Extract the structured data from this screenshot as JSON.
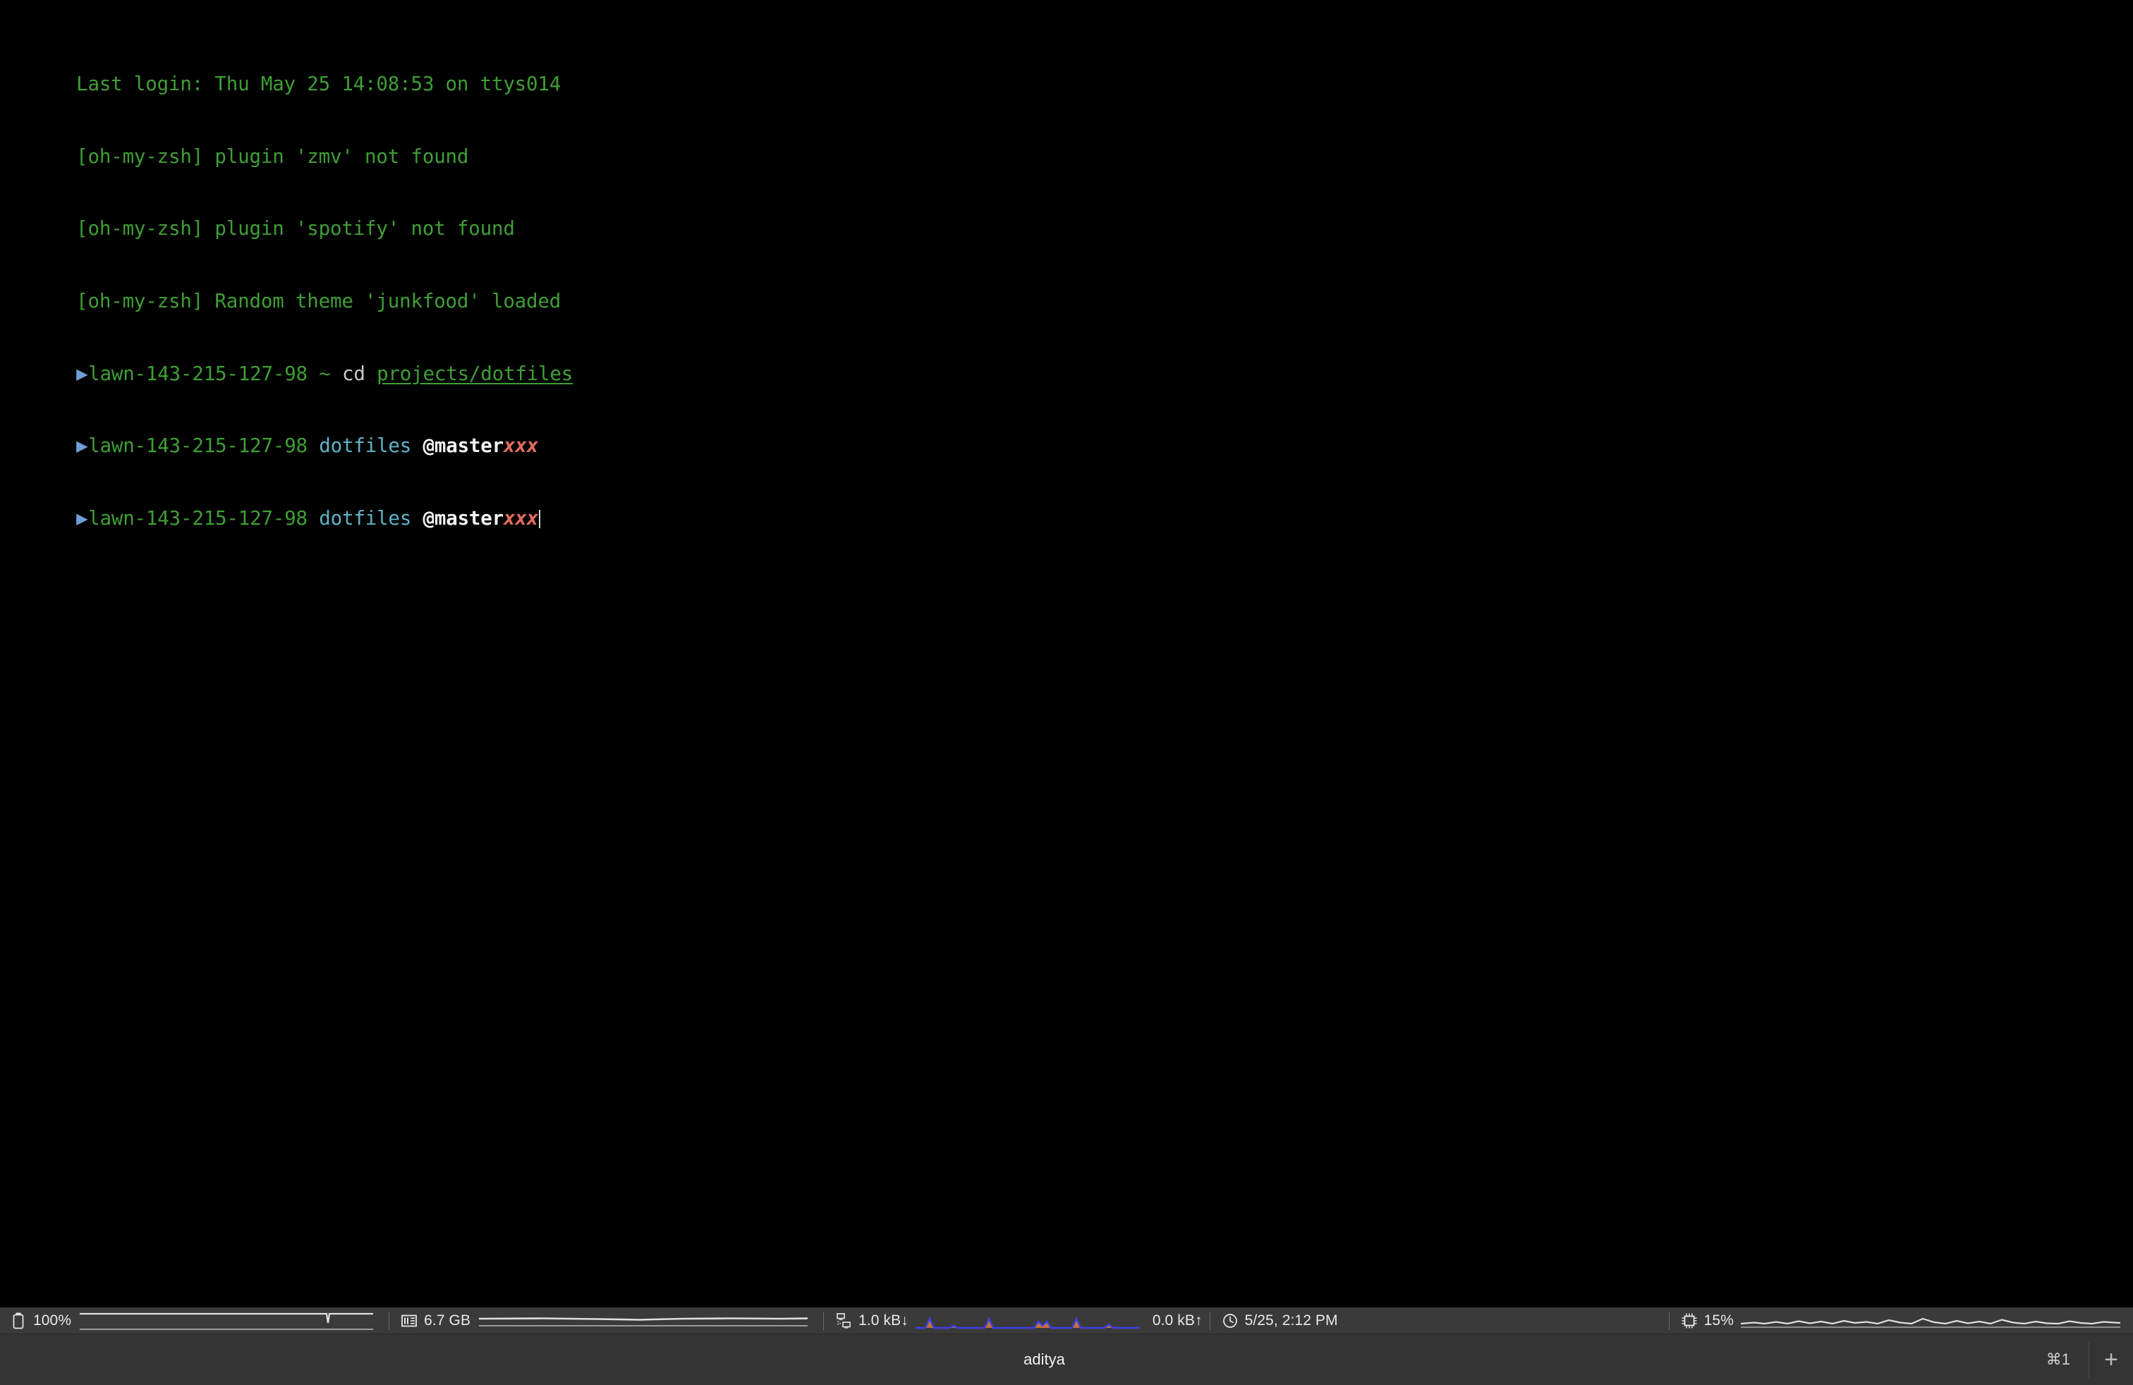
{
  "window": {
    "background_color": "#000000",
    "terminal_foreground": "#3f9e35"
  },
  "terminal": {
    "lines": [
      {
        "id": "login",
        "text": "Last login: Thu May 25 14:08:53 on ttys014"
      },
      {
        "id": "plugin-zmv",
        "text": "[oh-my-zsh] plugin 'zmv' not found"
      },
      {
        "id": "plugin-spotify",
        "text": "[oh-my-zsh] plugin 'spotify' not found"
      },
      {
        "id": "theme",
        "text": "[oh-my-zsh] Random theme 'junkfood' loaded"
      }
    ],
    "prompt_arrow": "▶",
    "prompt1": {
      "host": "lawn-143-215-127-98",
      "dir": "~",
      "command": "cd ",
      "path_arg": "projects/dotfiles"
    },
    "prompt2": {
      "host": "lawn-143-215-127-98",
      "dir": "dotfiles",
      "git_branch": "@master",
      "git_status": "xxx"
    },
    "prompt3": {
      "host": "lawn-143-215-127-98",
      "dir": "dotfiles",
      "git_branch": "@master",
      "git_status": "xxx"
    },
    "colors": {
      "green": "#3f9e35",
      "cyan": "#5fb3c8",
      "white": "#f2f2f2",
      "red": "#e06c5e",
      "arrow_blue": "#6f9fd8"
    }
  },
  "statusbar": {
    "background_color": "#3a3a3a",
    "battery": {
      "icon": "battery-icon",
      "value": "100%"
    },
    "memory": {
      "icon": "memory-chip-icon",
      "value": "6.7 GB"
    },
    "network": {
      "icon": "network-icon",
      "download": "1.0 kB↓",
      "upload": "0.0 kB↑",
      "line_color": "#3b40e8",
      "fill_color": "#e07a35"
    },
    "clock": {
      "icon": "clock-icon",
      "value": "5/25, 2:12 PM"
    },
    "cpu": {
      "icon": "cpu-icon",
      "value": "15%"
    }
  },
  "tabbar": {
    "background_color": "#343434",
    "tab_title": "aditya",
    "tab_shortcut": "⌘1",
    "new_tab_glyph": "+"
  }
}
